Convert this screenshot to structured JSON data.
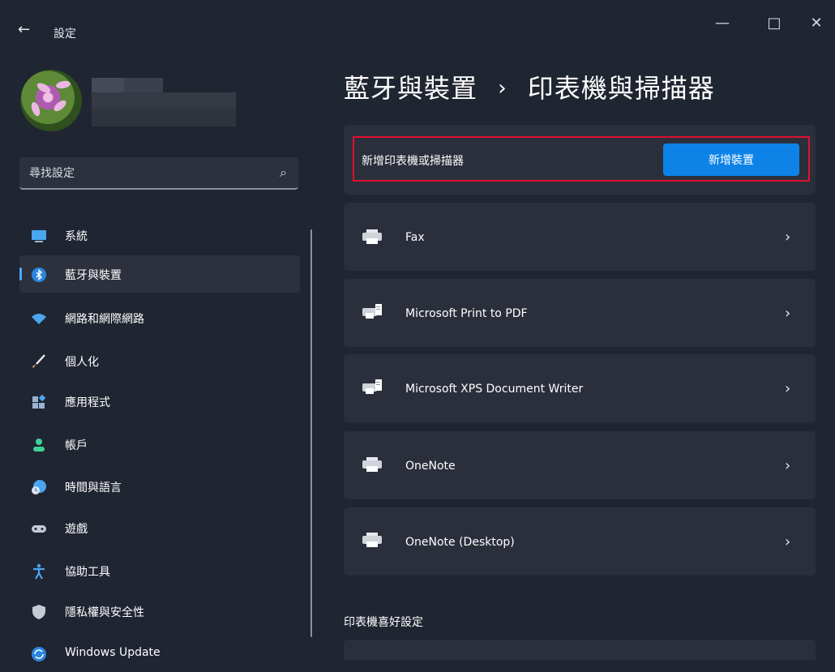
{
  "window": {
    "back": "←",
    "title": "設定",
    "minimize": "—",
    "maximize": "□",
    "close": "✕"
  },
  "search": {
    "placeholder": "尋找設定",
    "icon": "⌕"
  },
  "nav": {
    "items": [
      {
        "label": "系統",
        "icon": "monitor-icon",
        "color": "#4aa6ef"
      },
      {
        "label": "藍牙與裝置",
        "icon": "bluetooth-icon",
        "color": "#4aa6ef",
        "active": true
      },
      {
        "label": "網路和網際網路",
        "icon": "wifi-icon",
        "color": "#4aa6ef"
      },
      {
        "label": "個人化",
        "icon": "brush-icon",
        "color": "#e7b872"
      },
      {
        "label": "應用程式",
        "icon": "apps-icon",
        "color": "#9ab2d0"
      },
      {
        "label": "帳戶",
        "icon": "person-icon",
        "color": "#3fd09a"
      },
      {
        "label": "時間與語言",
        "icon": "globe-clock-icon",
        "color": "#4aa6ef"
      },
      {
        "label": "遊戲",
        "icon": "gamepad-icon",
        "color": "#c6cad4"
      },
      {
        "label": "協助工具",
        "icon": "accessibility-icon",
        "color": "#4aa6ef"
      },
      {
        "label": "隱私權與安全性",
        "icon": "shield-icon",
        "color": "#c6cad4"
      },
      {
        "label": "Windows Update",
        "icon": "update-icon",
        "color": "#4aa6ef"
      }
    ]
  },
  "page": {
    "breadcrumb_parent": "藍牙與裝置",
    "breadcrumb_sep": "›",
    "breadcrumb_current": "印表機與掃描器"
  },
  "add": {
    "label": "新增印表機或掃描器",
    "button": "新增裝置"
  },
  "devices": [
    {
      "name": "Fax",
      "icon": "printer-icon"
    },
    {
      "name": "Microsoft Print to PDF",
      "icon": "printer-document-icon"
    },
    {
      "name": "Microsoft XPS Document Writer",
      "icon": "printer-document-icon"
    },
    {
      "name": "OneNote",
      "icon": "printer-icon"
    },
    {
      "name": "OneNote (Desktop)",
      "icon": "printer-icon"
    }
  ],
  "preferences": {
    "title": "印表機喜好設定"
  },
  "colors": {
    "accent": "#0d83e8",
    "highlight": "#e0102e",
    "background": "#202532",
    "card": "#2a2f3b"
  }
}
